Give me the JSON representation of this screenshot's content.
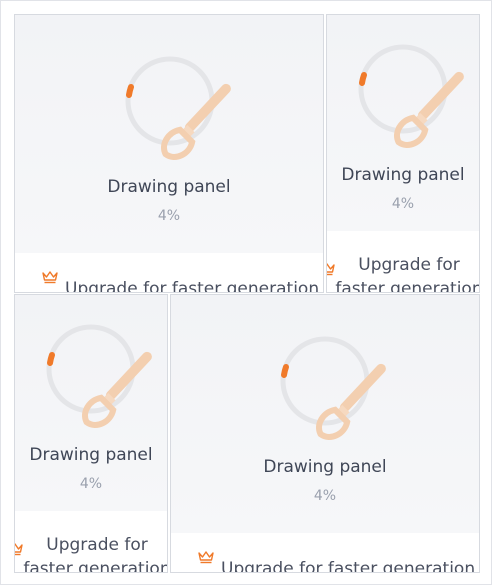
{
  "cards": [
    {
      "label": "Drawing panel",
      "progress_text": "4%",
      "progress_value": 0.04,
      "upgrade_text": "Upgrade for faster generation"
    },
    {
      "label": "Drawing panel",
      "progress_text": "4%",
      "progress_value": 0.04,
      "upgrade_text": "Upgrade for faster generation"
    },
    {
      "label": "Drawing panel",
      "progress_text": "4%",
      "progress_value": 0.04,
      "upgrade_text": "Upgrade for faster generation"
    },
    {
      "label": "Drawing panel",
      "progress_text": "4%",
      "progress_value": 0.04,
      "upgrade_text": "Upgrade for faster generation"
    }
  ],
  "colors": {
    "accent": "#f07a2a",
    "ring_track": "#e4e5e8",
    "brush": "#f3cfb0"
  },
  "icons": {
    "progress": "brush-icon",
    "upgrade": "crown-icon"
  }
}
